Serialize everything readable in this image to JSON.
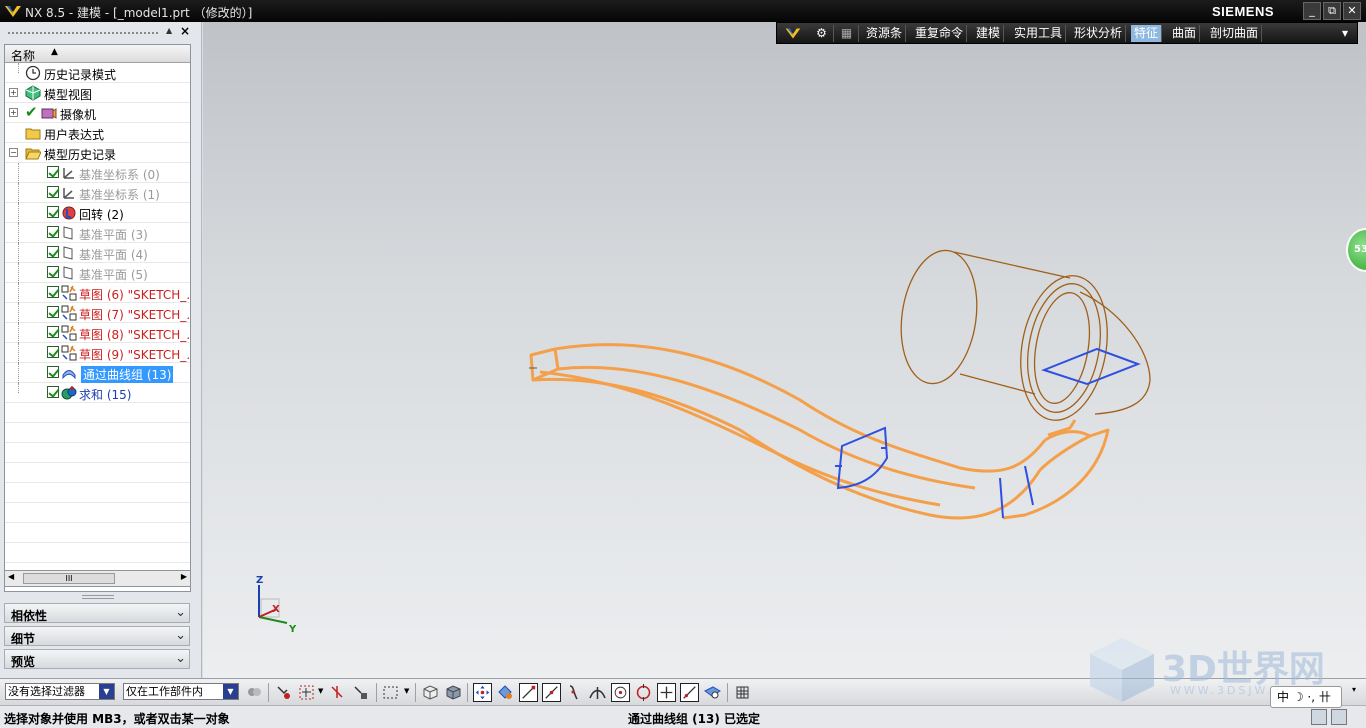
{
  "window": {
    "title": "NX 8.5 - 建模 - [_model1.prt （修改的）]",
    "brand": "SIEMENS",
    "controls": [
      "_",
      "⧉",
      "✕"
    ]
  },
  "command_bar": {
    "items": [
      "资源条",
      "重复命令",
      "建模",
      "实用工具",
      "形状分析",
      "特征",
      "曲面",
      "剖切曲面"
    ],
    "active": "特征"
  },
  "navigator": {
    "column_header": "名称",
    "rows": [
      {
        "label": "历史记录模式",
        "state": "normal",
        "icon": "clock-icon"
      },
      {
        "label": "模型视图",
        "state": "normal",
        "icon": "model-view-icon"
      },
      {
        "label": "摄像机",
        "state": "normal",
        "icon": "camera-icon"
      },
      {
        "label": "用户表达式",
        "state": "normal",
        "icon": "folder-icon"
      },
      {
        "label": "模型历史记录",
        "state": "normal",
        "icon": "folder-open-icon"
      },
      {
        "label": "基准坐标系 (0)",
        "state": "grey",
        "icon": "datum-csys-icon"
      },
      {
        "label": "基准坐标系 (1)",
        "state": "grey",
        "icon": "datum-csys-icon"
      },
      {
        "label": "回转 (2)",
        "state": "normal",
        "icon": "revolve-icon"
      },
      {
        "label": "基准平面 (3)",
        "state": "grey",
        "icon": "datum-plane-icon"
      },
      {
        "label": "基准平面 (4)",
        "state": "grey",
        "icon": "datum-plane-icon"
      },
      {
        "label": "基准平面 (5)",
        "state": "grey",
        "icon": "datum-plane-icon"
      },
      {
        "label": "草图 (6) \"SKETCH_…",
        "state": "red",
        "icon": "sketch-icon"
      },
      {
        "label": "草图 (7) \"SKETCH_…",
        "state": "red",
        "icon": "sketch-icon"
      },
      {
        "label": "草图 (8) \"SKETCH_…",
        "state": "red",
        "icon": "sketch-icon"
      },
      {
        "label": "草图 (9) \"SKETCH_…",
        "state": "red",
        "icon": "sketch-icon"
      },
      {
        "label": "通过曲线组 (13)",
        "state": "selected",
        "icon": "through-curves-icon"
      },
      {
        "label": "求和 (15)",
        "state": "blue",
        "icon": "unite-icon"
      }
    ],
    "sections": [
      "相依性",
      "细节",
      "预览"
    ],
    "scroll_thumb": "III"
  },
  "toolbar": {
    "filter_value": "没有选择过滤器",
    "scope_value": "仅在工作部件内"
  },
  "status": {
    "prompt": "选择对象并使用 MB3，或者双击某一对象",
    "selection": "通过曲线组 (13) 已选定"
  },
  "viewport": {
    "badge": "53",
    "triad_labels": {
      "z": "Z",
      "x": "X",
      "y": "Y"
    }
  },
  "ime": {
    "text": "中 ☽ ·, 卄"
  },
  "watermark": {
    "text": "3D世界网",
    "url": "WWW.3DSJW.COM"
  },
  "colors": {
    "accent_selection": "#3399ff",
    "model_wire": "#f4a04a",
    "section_curve": "#2f4fe0",
    "revolve_wire": "#a0601a"
  }
}
